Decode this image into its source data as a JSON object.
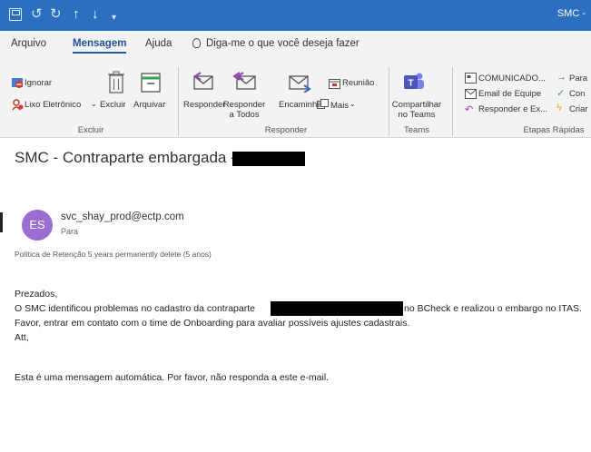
{
  "titlebar": {
    "title": "SMC -",
    "undo_glyph": "↺",
    "redo_glyph": "↻",
    "up_glyph": "↑",
    "down_glyph": "↓",
    "more_glyph": "▾",
    "bg_color": "#2b6fbf"
  },
  "tabs": [
    {
      "label": "Arquivo"
    },
    {
      "label": "Mensagem"
    },
    {
      "label": "Ajuda"
    }
  ],
  "tell_me": "Diga-me o que você deseja fazer",
  "ribbon": {
    "excluir": {
      "ignorar": "Ignorar",
      "lixo": "Lixo Eletrônico",
      "excluir": "Excluir",
      "arquivar": "Arquivar",
      "group_label": "Excluir"
    },
    "responder": {
      "responder": "Responder",
      "responder_todos_1": "Responder",
      "responder_todos_2": "a Todos",
      "encaminhar": "Encaminhar",
      "reuniao": "Reunião",
      "mais": "Mais",
      "group_label": "Responder"
    },
    "teams": {
      "line1": "Compartilhar",
      "line2": "no Teams",
      "group_label": "Teams"
    },
    "etapas": {
      "comunicado": "COMUNICADO...",
      "email_equipe": "Email de Equipe",
      "responder_ex": "Responder e Ex...",
      "para": "Para",
      "con": "Con",
      "criar": "Criar",
      "group_label": "Etapas Rápidas"
    }
  },
  "message": {
    "subject": "SMC - Contraparte embargada - ",
    "avatar_initials": "ES",
    "avatar_color": "#9b6dd0",
    "sender": "svc_shay_prod@ectp.com",
    "to_label": "Para",
    "retention": "Política de Retenção   5 years permanently delete (5 anos)",
    "greeting": "Prezados,",
    "line1_a": "O SMC identificou problemas no cadastro da contraparte",
    "line1_b": "no BCheck e realizou o embargo no ITAS.",
    "line2": "Favor, entrar em contato com o time de Onboarding para avaliar possíveis ajustes cadastrais.",
    "signoff": "Att,",
    "footer": "Esta é uma mensagem automática. Por favor, não responda a este e-mail."
  }
}
